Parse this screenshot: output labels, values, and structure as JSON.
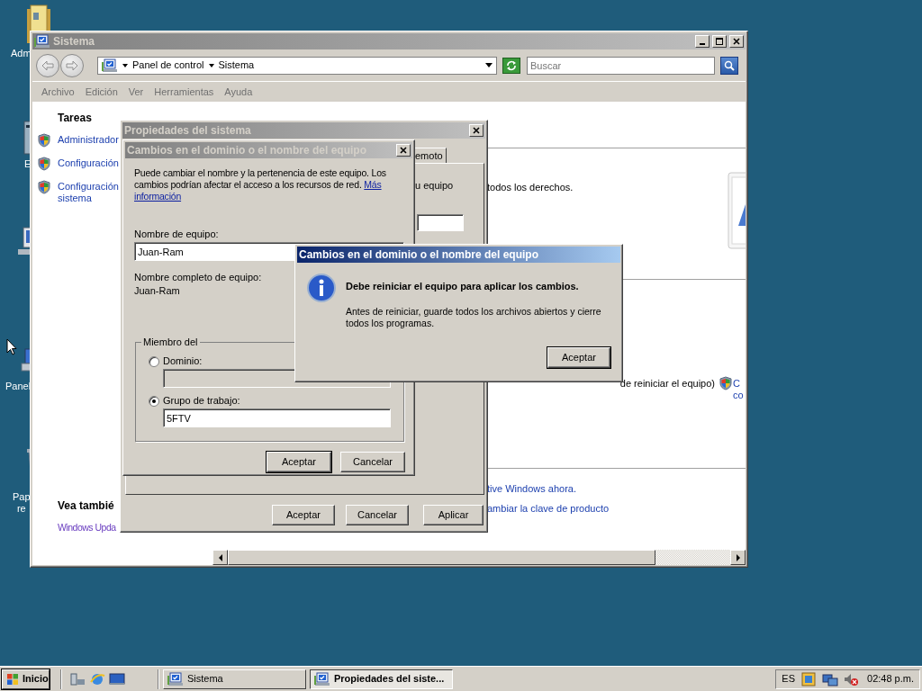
{
  "desktop": {
    "icons": [
      {
        "lines": [
          "Adm"
        ]
      },
      {
        "lines": [
          "E"
        ]
      },
      {
        "lines": [
          "Panel"
        ]
      },
      {
        "lines": [
          "Pap",
          "re"
        ]
      }
    ]
  },
  "system_window": {
    "title": "Sistema",
    "active": false,
    "breadcrumb": [
      "Panel de control",
      "Sistema"
    ],
    "search": {
      "placeholder": "Buscar"
    },
    "menu": [
      "Archivo",
      "Edición",
      "Ver",
      "Herramientas",
      "Ayuda"
    ],
    "tasks_heading": "Tareas",
    "tasks": [
      {
        "lines": [
          "Administrador"
        ]
      },
      {
        "lines": [
          "Configuración"
        ]
      },
      {
        "lines": [
          "Configuración",
          "sistema"
        ]
      }
    ],
    "content": {
      "copyright_fragment": "todos los derechos.",
      "rename_note_fragment": "de reiniciar el equipo)",
      "change_settings_link": [
        "C",
        "co"
      ],
      "activation_link": "tive Windows ahora.",
      "product_key_link": "ambiar la clave de producto"
    },
    "see_also": {
      "heading": "Vea tambié",
      "links": [
        "Windows Upda"
      ]
    }
  },
  "properties_window": {
    "title": "Propiedades del sistema",
    "active": false,
    "tab_fragment": "emoto",
    "text_fragment": "u equipo",
    "buttons": [
      "Aceptar",
      "Cancelar",
      "Aplicar"
    ]
  },
  "rename_dialog": {
    "title": "Cambios en el dominio o el nombre del equipo",
    "active": false,
    "description": "Puede cambiar el nombre y la pertenencia de este equipo. Los cambios podrían afectar el acceso a los recursos de red.",
    "more_link": [
      "Más",
      "información"
    ],
    "computer_name_label": "Nombre de equipo:",
    "computer_name": "Juan-Ram",
    "full_name_label": "Nombre completo de equipo:",
    "full_name": "Juan-Ram",
    "member_of": {
      "legend": "Miembro del",
      "options": [
        {
          "label": "Dominio:",
          "selected": false
        },
        {
          "label": "Grupo de trabajo:",
          "selected": true,
          "value": "5FTV"
        }
      ]
    },
    "buttons": [
      {
        "label": "Aceptar",
        "default": true
      },
      {
        "label": "Cancelar",
        "default": false
      }
    ]
  },
  "message_box": {
    "title": "Cambios en el dominio o el nombre del equipo",
    "active": true,
    "heading": "Debe reiniciar el equipo para aplicar los cambios.",
    "body": "Antes de reiniciar, guarde todos los archivos abiertos y cierre todos los programas.",
    "buttons": [
      {
        "label": "Aceptar",
        "default": true
      }
    ]
  },
  "taskbar": {
    "start": "Inicio",
    "tasks": [
      {
        "label": "Sistema",
        "selected": false
      },
      {
        "label": "Propiedades del siste...",
        "selected": true
      }
    ],
    "language": "ES",
    "clock": "02:48 p.m."
  }
}
